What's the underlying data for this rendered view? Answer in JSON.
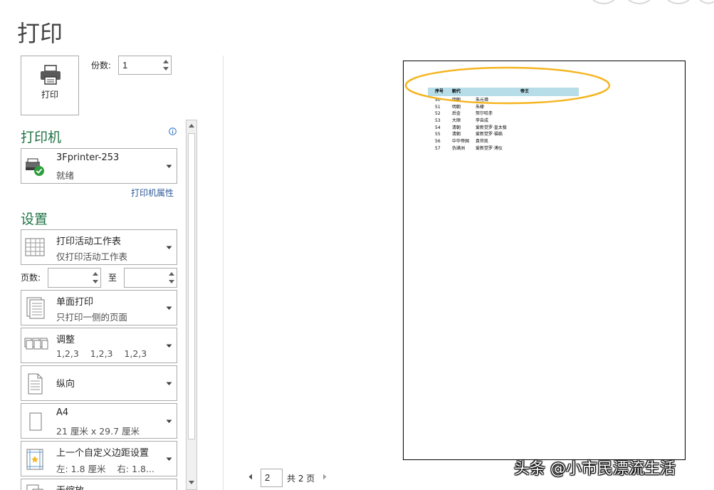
{
  "page": {
    "title": "打印"
  },
  "print_button": {
    "label": "打印",
    "icon": "printer-icon"
  },
  "copies": {
    "label": "份数:",
    "value": "1"
  },
  "printer": {
    "section_title": "打印机",
    "name": "3Fprinter-253",
    "status": "就绪",
    "properties_link": "打印机属性",
    "icon": "printer-ready-icon"
  },
  "settings": {
    "section_title": "设置",
    "items": [
      {
        "main": "打印活动工作表",
        "sub": "仅打印活动工作表",
        "icon": "sheet-icon"
      },
      {
        "main": "单面打印",
        "sub": "只打印一侧的页面",
        "icon": "single-sided-icon"
      },
      {
        "main": "调整",
        "sub": "1,2,3    1,2,3    1,2,3",
        "icon": "collate-icon"
      },
      {
        "main": "纵向",
        "sub": "",
        "icon": "portrait-icon"
      },
      {
        "main": "A4",
        "sub": "21 厘米 x 29.7 厘米",
        "icon": "paper-size-icon"
      },
      {
        "main": "上一个自定义边距设置",
        "sub": "左: 1.8 厘米    右: 1.8...",
        "icon": "margins-icon"
      },
      {
        "main": "无缩放",
        "sub": "",
        "icon": "scaling-icon"
      }
    ],
    "pages_label": "页数:",
    "pages_to_label": "至",
    "pages_from": "",
    "pages_to": ""
  },
  "preview": {
    "headers": [
      "序号",
      "朝代",
      "帝王"
    ],
    "rows": [
      [
        "50",
        "明朝",
        "朱元璋"
      ],
      [
        "51",
        "明朝",
        "朱棣"
      ],
      [
        "52",
        "后金",
        "努尔哈赤"
      ],
      [
        "53",
        "大顺",
        "李自成"
      ],
      [
        "54",
        "清朝",
        "爱新觉罗·皇太极"
      ],
      [
        "55",
        "清朝",
        "爱新觉罗·福临"
      ],
      [
        "56",
        "中华帝国",
        "袁世凯"
      ],
      [
        "57",
        "伪满洲",
        "爱新觉罗·溥仪"
      ]
    ],
    "header_fill": "#b7dde8",
    "highlight_color": "#f5b520"
  },
  "page_nav": {
    "current": "2",
    "total_text": "共 2 页"
  },
  "watermark": "头条 @小市民漂流生活",
  "colors": {
    "accent": "#217346",
    "link": "#2b5797",
    "border": "#ababab"
  }
}
